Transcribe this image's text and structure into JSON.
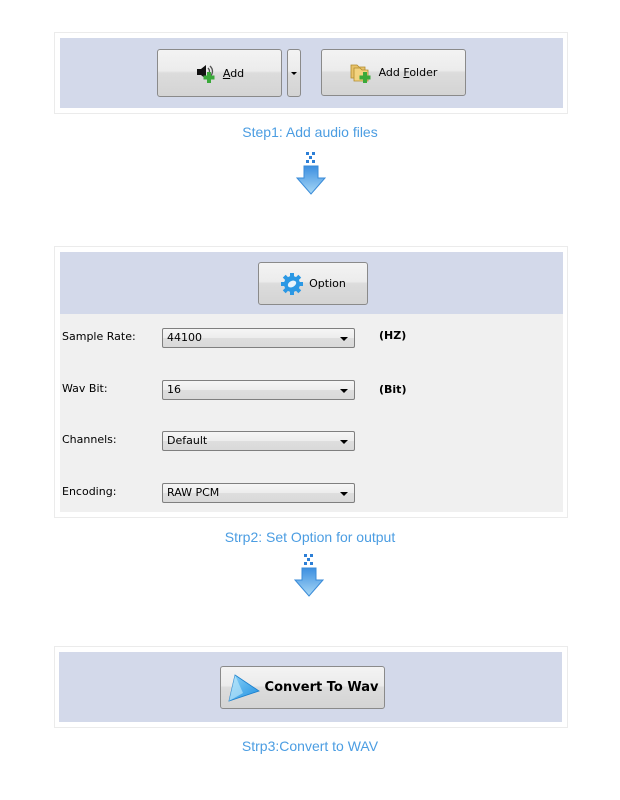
{
  "step1": {
    "add_button": {
      "label_accel": "A",
      "label_rest": "dd",
      "icon": "speaker-add-icon"
    },
    "add_dropdown": {
      "icon": "chevron-down-icon"
    },
    "add_folder_button": {
      "label_pre": "Add ",
      "label_accel": "F",
      "label_rest": "older",
      "icon": "folder-add-icon"
    },
    "caption": "Step1: Add audio files"
  },
  "step2": {
    "option_button": {
      "label": "Option",
      "icon": "gear-icon"
    },
    "fields": [
      {
        "label": "Sample Rate:",
        "value": "44100",
        "unit": "(HZ)"
      },
      {
        "label": "Wav Bit:",
        "value": "16",
        "unit": "(Bit)"
      },
      {
        "label": "Channels:",
        "value": "Default",
        "unit": ""
      },
      {
        "label": "Encoding:",
        "value": "RAW PCM",
        "unit": ""
      }
    ],
    "caption": "Strp2: Set Option for output"
  },
  "step3": {
    "convert_button": {
      "label": "Convert To Wav",
      "icon": "play-icon"
    },
    "caption": "Strp3:Convert to WAV"
  },
  "colors": {
    "caption": "#4b9de2",
    "panel_blue": "#d3d9ea",
    "panel_gray": "#f0f0f0"
  }
}
